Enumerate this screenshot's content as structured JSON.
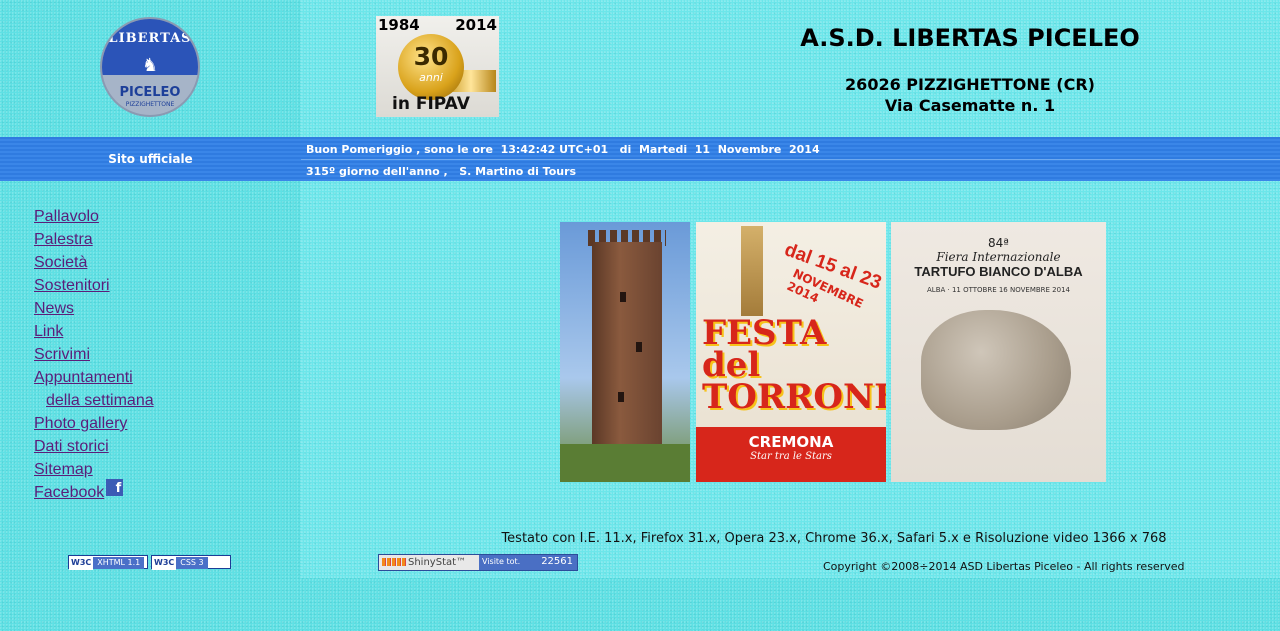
{
  "header": {
    "logo_top": "LIBERTAS",
    "logo_bottom": "PICELEO",
    "logo_sub": "PIZZIGHETTONE",
    "badge_year_start": "1984",
    "badge_year_end": "2014",
    "badge_number": "30",
    "badge_anni": "anni",
    "badge_fipav": "in FIPAV",
    "title": "A.S.D. LIBERTAS PICELEO",
    "address_line1": "26026 PIZZIGHETTONE (CR)",
    "address_line2": "Via Casematte n. 1"
  },
  "bar": {
    "site_label": "Sito ufficiale",
    "greeting": "Buon Pomeriggio , sono le ore  13:42:42 UTC+01   di  Martedi  11  Novembre  2014",
    "day_info": "315º giorno dell'anno ,   S. Martino di Tours"
  },
  "menu": [
    {
      "label": "Pallavolo"
    },
    {
      "label": "Palestra"
    },
    {
      "label": "Società"
    },
    {
      "label": "Sostenitori"
    },
    {
      "label": "News"
    },
    {
      "label": "Link"
    },
    {
      "label": "Scrivimi"
    },
    {
      "label": "Appuntamenti"
    },
    {
      "label": "della settimana"
    },
    {
      "label": "Photo gallery"
    },
    {
      "label": "Dati storici"
    },
    {
      "label": "Sitemap"
    },
    {
      "label": "Facebook"
    }
  ],
  "facebook_icon": "f",
  "validators": {
    "xhtml": "XHTML 1.1",
    "css": "CSS 3",
    "w3c": "W3C"
  },
  "pictures": {
    "torrone_dates": "dal 15 al 23",
    "torrone_month": "NOVEMBRE 2014",
    "torrone_title": "FESTA del TORRONE",
    "torrone_city": "CREMONA",
    "torrone_tagline": "Star tra le Stars",
    "tartufo_edition": "84ª",
    "tartufo_fiera": "Fiera Internazionale",
    "tartufo_title": "TARTUFO BIANCO D'ALBA",
    "tartufo_dates": "ALBA · 11 OTTOBRE 16 NOVEMBRE 2014"
  },
  "footer": {
    "tested": "Testato con I.E. 11.x, Firefox 31.x, Opera 23.x, Chrome 36.x, Safari 5.x e Risoluzione video 1366 x 768",
    "copyright": "Copyright ©2008÷2014 ASD Libertas Piceleo - All rights reserved",
    "shinystat_label": "ShinyStat™",
    "visite_label": "Visite tot.",
    "visite_count": "22561"
  },
  "colors": {
    "background": "#5fe0e4",
    "bar_blue": "#2f7be0",
    "menu_link": "#5b1e7a"
  }
}
